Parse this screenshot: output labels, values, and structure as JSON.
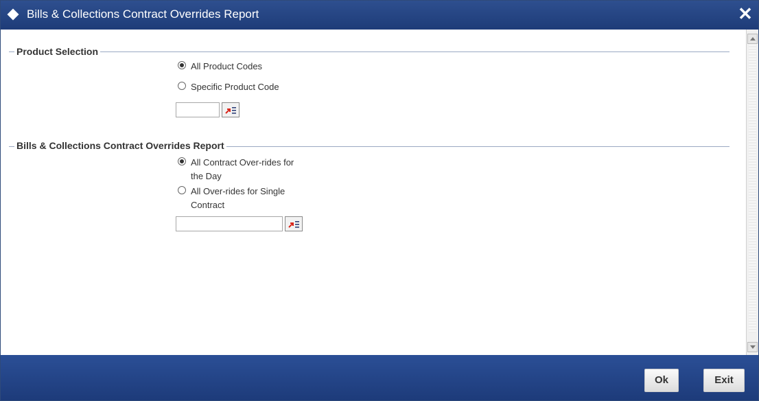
{
  "window": {
    "title": "Bills & Collections Contract Overrides Report",
    "close_symbol": "✕"
  },
  "product_selection": {
    "legend": "Product Selection",
    "options": [
      {
        "label": "All Product Codes",
        "checked": true
      },
      {
        "label": "Specific Product Code",
        "checked": false
      }
    ],
    "product_code_value": ""
  },
  "overrides_report": {
    "legend": "Bills & Collections Contract Overrides Report",
    "options": [
      {
        "label_line1": "All Contract Over-rides for",
        "label_line2": "the Day",
        "checked": true
      },
      {
        "label_line1": "All Over-rides for Single",
        "label_line2": "Contract",
        "checked": false
      }
    ],
    "contract_value": ""
  },
  "footer": {
    "ok_label": "Ok",
    "exit_label": "Exit"
  },
  "colors": {
    "titlebar": "#1e3c78",
    "footer": "#1d3b7a",
    "lov_icon_red": "#d9261c"
  },
  "icons": {
    "title_icon": "diamond-icon",
    "lov_icon": "list-of-values-icon"
  }
}
